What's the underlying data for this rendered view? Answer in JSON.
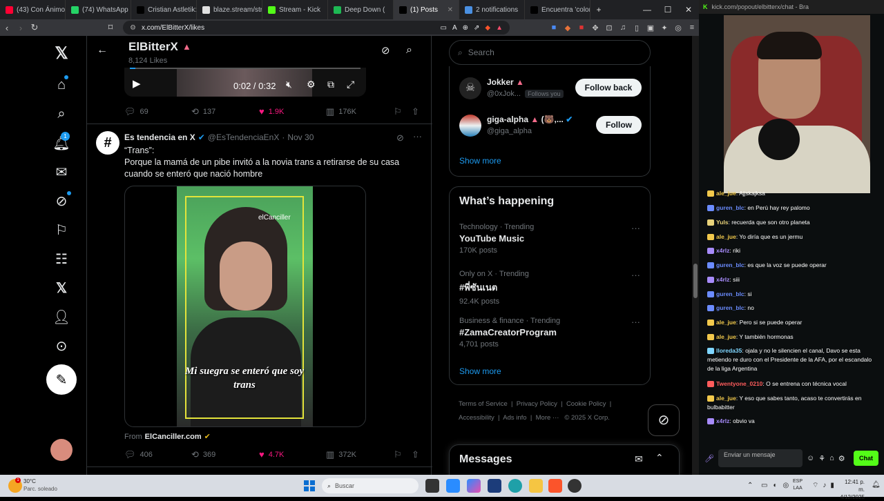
{
  "browser": {
    "tabs": [
      {
        "label": "(43) Con Ánimo d",
        "color": "#ff0033",
        "active": false
      },
      {
        "label": "(74) WhatsApp",
        "color": "#25d366",
        "active": false
      },
      {
        "label": "Cristian Astletik: L",
        "color": "#000000",
        "active": false
      },
      {
        "label": "blaze.stream/stre",
        "color": "#e0e0e0",
        "active": false
      },
      {
        "label": "Stream - Kick",
        "color": "#53fc18",
        "active": false
      },
      {
        "label": "Deep Down (",
        "color": "#1db954",
        "active": false
      },
      {
        "label": "(1) Posts",
        "color": "#000000",
        "active": true
      },
      {
        "label": "2 notifications",
        "color": "#4a90e2",
        "active": false
      },
      {
        "label": "Encuentra 'colom",
        "color": "#000000",
        "active": false
      }
    ],
    "new_tab": "+",
    "url": "x.com/ElBitterX/likes",
    "min": "—",
    "max": "☐",
    "close": "✕"
  },
  "header": {
    "name": "ElBitterX",
    "subtitle": "8,124 Likes"
  },
  "video1": {
    "time": "0:02 / 0:32",
    "stats": {
      "replies": "69",
      "reposts": "137",
      "likes": "1.9K",
      "views": "176K"
    }
  },
  "post": {
    "author": "Es tendencia en X",
    "handle": "@EsTendenciaEnX",
    "date": "Nov 30",
    "line1": "“Trans”:",
    "line2": "Porque la mamá de un pibe invitó a la novia trans a retirarse de su casa",
    "line3": "cuando se enteró que nació hombre",
    "video_watermark": "elCanciller",
    "video_caption": "Mi suegra se enteró que soy trans",
    "from_prefix": "From",
    "from_source": "ElCanciller.com",
    "stats": {
      "replies": "406",
      "reposts": "369",
      "likes": "4.7K",
      "views": "372K"
    }
  },
  "search": {
    "placeholder": "Search"
  },
  "follow": {
    "users": [
      {
        "name": "Jokker",
        "handle": "@0xJok...",
        "tag": "Follows you",
        "button": "Follow back"
      },
      {
        "name": "giga-alpha",
        "handle": "@giga_alpha",
        "tag": "",
        "button": "Follow"
      }
    ],
    "show_more": "Show more"
  },
  "happening": {
    "title": "What’s happening",
    "trends": [
      {
        "meta": "Technology · Trending",
        "title": "YouTube Music",
        "posts": "170K posts"
      },
      {
        "meta": "Only on X · Trending",
        "title": "#พี่ซันเนต",
        "posts": "92.4K posts"
      },
      {
        "meta": "Business & finance · Trending",
        "title": "#ZamaCreatorProgram",
        "posts": "4,701 posts"
      }
    ],
    "show_more": "Show more"
  },
  "footer": {
    "links": [
      "Terms of Service",
      "Privacy Policy",
      "Cookie Policy",
      "Accessibility",
      "Ads info",
      "More ···"
    ],
    "copyright": "© 2025 X Corp."
  },
  "messages": {
    "title": "Messages"
  },
  "kick": {
    "url": "kick.com/popout/elbitterx/chat - Bra",
    "chat": [
      {
        "user": "ale_jue",
        "color": "#f2c94c",
        "text": "Ajjskajksa"
      },
      {
        "user": "guren_blc",
        "color": "#6b8cff",
        "text": "en Perú hay rey palomo"
      },
      {
        "user": "Yuls",
        "color": "#e8d27a",
        "text": "recuerda que son otro planeta"
      },
      {
        "user": "ale_jue",
        "color": "#f2c94c",
        "text": "Yo diría que es un jermu"
      },
      {
        "user": "x4rlz",
        "color": "#a78bfa",
        "text": "riki"
      },
      {
        "user": "guren_blc",
        "color": "#6b8cff",
        "text": "es que la voz se puede operar"
      },
      {
        "user": "x4rlz",
        "color": "#a78bfa",
        "text": "siii"
      },
      {
        "user": "guren_blc",
        "color": "#6b8cff",
        "text": "si"
      },
      {
        "user": "guren_blc",
        "color": "#6b8cff",
        "text": "no"
      },
      {
        "user": "ale_jue",
        "color": "#f2c94c",
        "text": "Pero si se puede operar"
      },
      {
        "user": "ale_jue",
        "color": "#f2c94c",
        "text": "Y también hormonas"
      },
      {
        "user": "lloreda35",
        "color": "#7fd6ff",
        "text": "ojala y no le silencien el canal, Davo se esta metiendo re duro con el Presidente de la AFA, por el escandalo de la liga Argentina"
      },
      {
        "user": "Twentyone_0210",
        "color": "#ff5c5c",
        "text": "O se entrena con técnica vocal"
      },
      {
        "user": "ale_jue",
        "color": "#f2c94c",
        "text": "Y eso que sabes tanto, acaso te convertirás en bulbabitter"
      },
      {
        "user": "x4rlz",
        "color": "#a78bfa",
        "text": "obvio va"
      }
    ],
    "input_placeholder": "Enviar un mensaje",
    "chat_button": "Chat"
  },
  "taskbar": {
    "weather_temp": "30°C",
    "weather_desc": "Parc. soleado",
    "search": "Buscar",
    "lang": "ESP",
    "lang2": "LAA",
    "time": "12:41 p. m.",
    "date": "4/12/2025"
  }
}
